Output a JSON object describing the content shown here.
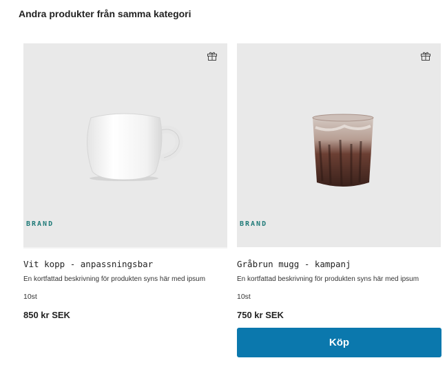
{
  "section": {
    "title": "Andra produkter från samma kategori"
  },
  "products": [
    {
      "brand": "BRAND",
      "name": "Vit kopp - anpassningsbar",
      "description": "En kortfattad beskrivning för produkten syns här med ipsum",
      "quantity": "10st",
      "price": "850 kr SEK",
      "image": "white-cup",
      "icon": "gift-icon"
    },
    {
      "brand": "BRAND",
      "name": "Gråbrun mugg - kampanj",
      "description": "En kortfattad beskrivning för produkten syns här med ipsum",
      "quantity": "10st",
      "price": "750 kr SEK",
      "image": "brown-mug",
      "icon": "gift-icon",
      "buy_label": "Köp"
    }
  ],
  "colors": {
    "brand_text": "#1f7a78",
    "buy_button": "#0b78ad",
    "image_bg": "#e9e9e9"
  }
}
